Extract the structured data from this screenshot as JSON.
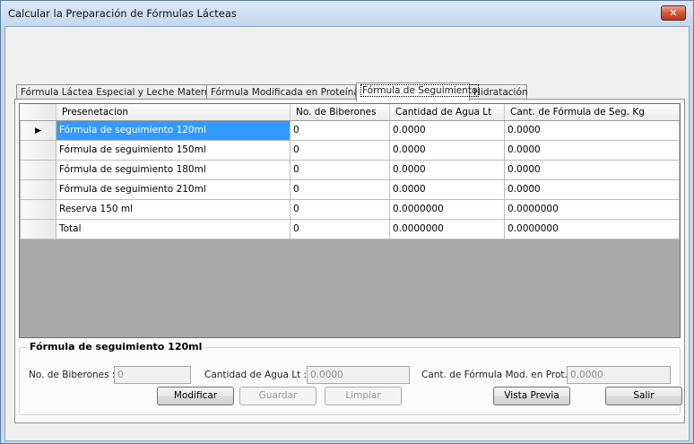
{
  "window": {
    "title": "Calcular la Preparación de Fórmulas Lácteas",
    "close_label": "✕"
  },
  "tabs": [
    {
      "label": "Fórmula Láctea Especial y Leche Materna"
    },
    {
      "label": "Fórmula Modificada en Proteínas"
    },
    {
      "label": "Fórmula de Seguimiento"
    },
    {
      "label": "Hidratación"
    }
  ],
  "active_tab": 2,
  "grid": {
    "columns": [
      "Presenetacion",
      "No. de Biberones",
      "Cantidad de Agua Lt",
      "Cant. de Fórmula de Seg. Kg"
    ],
    "rows": [
      [
        "Fórmula de seguimiento 120ml",
        "0",
        "0.0000",
        "0.0000"
      ],
      [
        "Fórmula de seguimiento 150ml",
        "0",
        "0.0000",
        "0.0000"
      ],
      [
        "Fórmula de seguimiento 180ml",
        "0",
        "0.0000",
        "0.0000"
      ],
      [
        "Fórmula de seguimiento 210ml",
        "0",
        "0.0000",
        "0.0000"
      ],
      [
        "Reserva 150 ml",
        "0",
        "0.0000000",
        "0.0000000"
      ],
      [
        "Total",
        "0",
        "0.0000000",
        "0.0000000"
      ]
    ],
    "current_row_indicator": "▶"
  },
  "group": {
    "title": "Fórmula de seguimiento 120ml",
    "biberones_label": "No. de Biberones :",
    "biberones_value": "0",
    "agua_label": "Cantidad de Agua Lt :",
    "agua_value": "0.0000",
    "formula_label": "Cant. de Fórmula Mod. en Prot. :",
    "formula_value": "0.0000"
  },
  "buttons": {
    "modificar": "Modificar",
    "guardar": "Guardar",
    "limpiar": "Limpiar",
    "vista_previa": "Vista Previa",
    "salir": "Salir"
  }
}
